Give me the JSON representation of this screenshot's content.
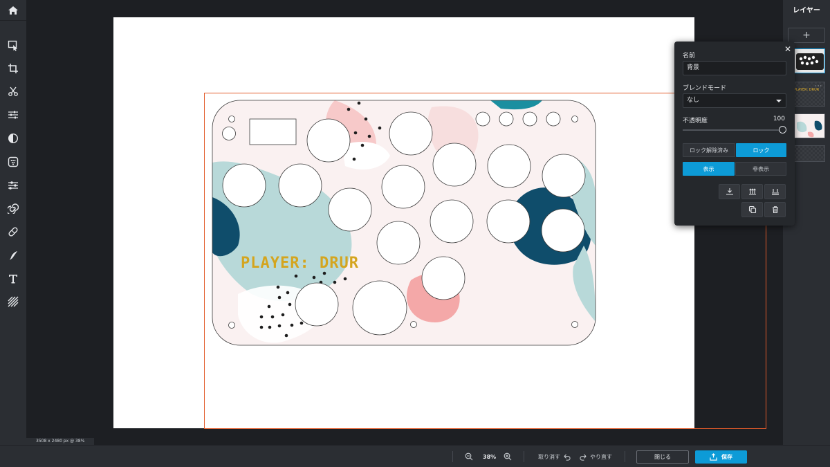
{
  "toolbar": {
    "tools": [
      {
        "name": "home-icon"
      },
      {
        "name": "select-icon"
      },
      {
        "name": "crop-icon"
      },
      {
        "name": "cut-icon"
      },
      {
        "name": "adjust-icon"
      },
      {
        "name": "filter-icon"
      },
      {
        "name": "effects-icon"
      },
      {
        "name": "liquify-icon"
      },
      {
        "name": "distort-icon"
      },
      {
        "name": "retouch-icon"
      },
      {
        "name": "draw-icon"
      },
      {
        "name": "text-icon"
      },
      {
        "name": "texture-icon"
      }
    ]
  },
  "canvas": {
    "design_text": "PLAYER: DRUR",
    "accent_color": "#e25b2a",
    "status": "3508 x 2480 px @ 38%"
  },
  "layers": {
    "title": "レイヤー",
    "add_label": "+",
    "more_label": "···",
    "thumb_text": "PLAYER: DRUR"
  },
  "props": {
    "close_label": "✕",
    "name_label": "名前",
    "name_value": "背景",
    "blend_label": "ブレンドモード",
    "blend_value": "なし",
    "opacity_label": "不透明度",
    "opacity_value": "100",
    "opacity": 1.0,
    "unlocked_label": "ロック解除済み",
    "lock_label": "ロック",
    "show_label": "表示",
    "hide_label": "非表示",
    "icons": [
      "align-bottom-icon",
      "align-middle-icon",
      "align-top-icon",
      "duplicate-icon",
      "trash-icon"
    ]
  },
  "bottom": {
    "zoom_value": "38%",
    "undo_label": "取り消す",
    "redo_label": "やり直す",
    "close_label": "閉じる",
    "save_label": "保存"
  },
  "colors": {
    "brand": "#0d9bd7",
    "panel": "#2b2e33"
  }
}
